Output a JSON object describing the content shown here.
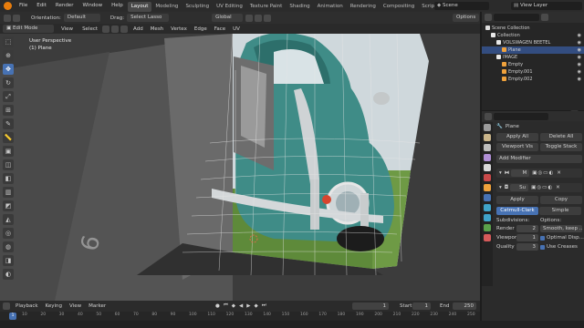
{
  "menu": {
    "items": [
      "File",
      "Edit",
      "Render",
      "Window",
      "Help"
    ],
    "workspaces": [
      "Layout",
      "Modeling",
      "Sculpting",
      "UV Editing",
      "Texture Paint",
      "Shading",
      "Animation",
      "Rendering",
      "Compositing",
      "Scripting"
    ],
    "active_workspace": "Layout",
    "scene_label": "Scene",
    "view_layer_label": "View Layer"
  },
  "viewport_header": {
    "orientation_label": "Orientation:",
    "orientation_value": "Default",
    "drag_label": "Drag:",
    "drag_value": "Select Lasso",
    "transform_value": "Global",
    "options_label": "Options",
    "mode_value": "Edit Mode",
    "menus": [
      "View",
      "Select",
      "Add",
      "Mesh",
      "Vertex",
      "Edge",
      "Face",
      "UV"
    ]
  },
  "viewport": {
    "perspective_label": "User Perspective",
    "object_label": "(1) Plane"
  },
  "timeline": {
    "menus": [
      "Playback",
      "Keying",
      "View",
      "Marker"
    ],
    "current_frame": "1",
    "start_label": "Start",
    "start_value": "1",
    "end_label": "End",
    "end_value": "250",
    "ruler_ticks": [
      "10",
      "20",
      "30",
      "40",
      "50",
      "60",
      "70",
      "80",
      "90",
      "100",
      "110",
      "120",
      "130",
      "140",
      "150",
      "160",
      "170",
      "180",
      "190",
      "200",
      "210",
      "220",
      "230",
      "240",
      "250"
    ]
  },
  "outliner": {
    "root": "Scene Collection",
    "rows": [
      {
        "label": "Collection",
        "indent": 1
      },
      {
        "label": "VOLSWAGEN BEETEL",
        "indent": 2
      },
      {
        "label": "Plane",
        "indent": 3,
        "selected": true
      },
      {
        "label": "IMAGE",
        "indent": 2
      },
      {
        "label": "Empty",
        "indent": 3
      },
      {
        "label": "Empty.001",
        "indent": 3
      },
      {
        "label": "Empty.002",
        "indent": 3
      }
    ]
  },
  "properties": {
    "object_name": "Plane",
    "apply_all_label": "Apply All",
    "delete_all_label": "Delete All",
    "viewport_vis_label": "Viewport Vis",
    "toggle_stack_label": "Toggle Stack",
    "add_modifier_label": "Add Modifier",
    "modifier1_short": "M",
    "modifier2_short": "Su",
    "apply_label": "Apply",
    "copy_label": "Copy",
    "tab_catmull": "Catmull-Clark",
    "tab_simple": "Simple",
    "subdivisions_label": "Subdivisions:",
    "options_label": "Options:",
    "render_label": "Render",
    "render_value": "2",
    "viewport_label": "Viewport",
    "viewport_value": "1",
    "quality_label": "Quality",
    "quality_value": "3",
    "uv_smooth_value": "Smooth, keep ...",
    "optimal_display_label": "Optimal Disp...",
    "use_creases_label": "Use Creases"
  },
  "colors": {
    "accent_blue": "#4772b3",
    "blender_orange": "#e87d0d",
    "car_teal": "#3f8c87"
  }
}
